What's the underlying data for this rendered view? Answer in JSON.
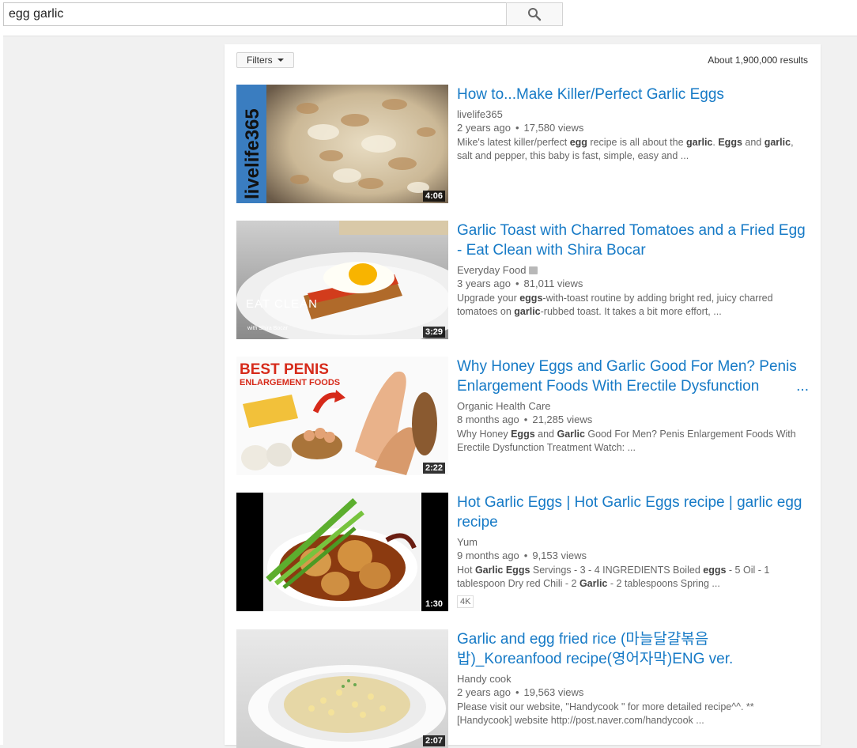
{
  "search": {
    "value": "egg garlic",
    "placeholder": "Search"
  },
  "filters_label": "Filters",
  "result_count": "About 1,900,000 results",
  "results": [
    {
      "title": "How to...Make Killer/Perfect Garlic Eggs",
      "channel": "livelife365",
      "age": "2 years ago",
      "views": "17,580 views",
      "desc": [
        {
          "t": "Mike's latest killer/perfect ",
          "b": false
        },
        {
          "t": "egg",
          "b": true
        },
        {
          "t": " recipe is all about the ",
          "b": false
        },
        {
          "t": "garlic",
          "b": true
        },
        {
          "t": ". ",
          "b": false
        },
        {
          "t": "Eggs",
          "b": true
        },
        {
          "t": " and ",
          "b": false
        },
        {
          "t": "garlic",
          "b": true
        },
        {
          "t": ", salt and pepper, this baby is fast, simple, easy and ...",
          "b": false
        }
      ],
      "duration": "4:06",
      "thumb_text": "livelife365"
    },
    {
      "title": "Garlic Toast with Charred Tomatoes and a Fried Egg - Eat Clean with Shira Bocar",
      "channel": "Everyday Food",
      "age": "3 years ago",
      "views": "81,011 views",
      "desc": [
        {
          "t": "Upgrade your ",
          "b": false
        },
        {
          "t": "eggs",
          "b": true
        },
        {
          "t": "-with-toast routine by adding bright red, juicy charred tomatoes on ",
          "b": false
        },
        {
          "t": "garlic",
          "b": true
        },
        {
          "t": "-rubbed toast. It takes a bit more effort, ...",
          "b": false
        }
      ],
      "duration": "3:29",
      "thumb_text": "EAT CLEAN",
      "thumb_sub": "with Shira Bocar"
    },
    {
      "title": "Why Honey Eggs and Garlic Good For Men? Penis Enlargement Foods With Erectile Dysfunction",
      "title_more": "...",
      "channel": "Organic Health Care",
      "age": "8 months ago",
      "views": "21,285 views",
      "desc": [
        {
          "t": "Why Honey ",
          "b": false
        },
        {
          "t": "Eggs",
          "b": true
        },
        {
          "t": " and ",
          "b": false
        },
        {
          "t": "Garlic",
          "b": true
        },
        {
          "t": " Good For Men? Penis Enlargement Foods With Erectile Dysfunction Treatment Watch: ...",
          "b": false
        }
      ],
      "duration": "2:22",
      "thumb_text": "BEST PENIS",
      "thumb_sub": "ENLARGEMENT FOODS"
    },
    {
      "title": "Hot Garlic Eggs | Hot Garlic Eggs recipe | garlic egg recipe",
      "channel": "Yum",
      "age": "9 months ago",
      "views": "9,153 views",
      "desc": [
        {
          "t": "Hot ",
          "b": false
        },
        {
          "t": "Garlic Eggs",
          "b": true
        },
        {
          "t": " Servings - 3 - 4 INGREDIENTS Boiled ",
          "b": false
        },
        {
          "t": "eggs",
          "b": true
        },
        {
          "t": " - 5 Oil - 1 tablespoon Dry red Chili - 2 ",
          "b": false
        },
        {
          "t": "Garlic",
          "b": true
        },
        {
          "t": " - 2 tablespoons Spring ...",
          "b": false
        }
      ],
      "duration": "1:30",
      "badge": "4K"
    },
    {
      "title": "Garlic and egg fried rice (마늘달걀볶음밥)_Koreanfood recipe(영어자막)ENG ver.",
      "channel": "Handy cook",
      "age": "2 years ago",
      "views": "19,563 views",
      "desc": [
        {
          "t": "Please visit our website, \"Handycook \" for more detailed recipe^^. ** [Handycook] website http://post.naver.com/handycook ...",
          "b": false
        }
      ],
      "duration": "2:07"
    }
  ],
  "colors": {
    "link": "#167ac6",
    "meta": "#666666",
    "page_bg": "#f1f1f1"
  }
}
